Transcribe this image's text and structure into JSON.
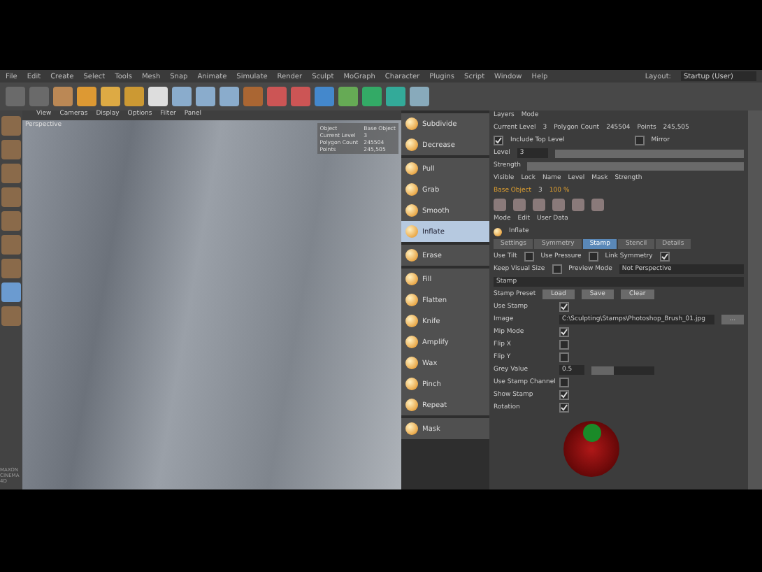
{
  "menu": [
    "File",
    "Edit",
    "Create",
    "Select",
    "Tools",
    "Mesh",
    "Snap",
    "Animate",
    "Simulate",
    "Render",
    "Sculpt",
    "MoGraph",
    "Character",
    "Plugins",
    "Script",
    "Window",
    "Help"
  ],
  "layout": {
    "label": "Layout:",
    "value": "Startup (User)"
  },
  "viewport": {
    "menu": [
      "View",
      "Cameras",
      "Display",
      "Options",
      "Filter",
      "Panel"
    ],
    "camera": "Perspective",
    "hud": [
      {
        "label": "Object",
        "value": "Base Object"
      },
      {
        "label": "Current Level",
        "value": "3"
      },
      {
        "label": "Polygon Count",
        "value": "245504"
      },
      {
        "label": "Points",
        "value": "245,505"
      }
    ]
  },
  "logo": {
    "name": "MAXON",
    "sub": "CINEMA 4D"
  },
  "brush_groups": [
    [
      {
        "label": "Subdivide",
        "selected": false
      },
      {
        "label": "Decrease",
        "selected": false
      }
    ],
    [
      {
        "label": "Pull",
        "selected": false
      },
      {
        "label": "Grab",
        "selected": false
      },
      {
        "label": "Smooth",
        "selected": false
      },
      {
        "label": "Inflate",
        "selected": true
      }
    ],
    [
      {
        "label": "Erase",
        "selected": false
      }
    ],
    [
      {
        "label": "Fill",
        "selected": false
      },
      {
        "label": "Flatten",
        "selected": false
      },
      {
        "label": "Knife",
        "selected": false
      },
      {
        "label": "Amplify",
        "selected": false
      },
      {
        "label": "Wax",
        "selected": false
      },
      {
        "label": "Pinch",
        "selected": false
      },
      {
        "label": "Repeat",
        "selected": false
      }
    ],
    [
      {
        "label": "Mask",
        "selected": false
      }
    ]
  ],
  "layers": {
    "menu": [
      "Layers",
      "Mode"
    ],
    "current_level": {
      "label": "Current Level",
      "value": "3"
    },
    "polygons": {
      "label": "Polygon Count",
      "value": "245504"
    },
    "points": {
      "label": "Points",
      "value": "245,505"
    },
    "include_top": {
      "label": "Include Top Level",
      "checked": true
    },
    "mirror": {
      "label": "Mirror",
      "checked": false
    },
    "level_label": "Level",
    "level_value": "3",
    "strength_label": "Strength",
    "columns": [
      "Visible",
      "Lock",
      "Name",
      "Level",
      "Mask",
      "Strength"
    ],
    "row": {
      "name": "Base Object",
      "level": "3",
      "strength": "100 %"
    }
  },
  "attributes": {
    "menu": [
      "Mode",
      "Edit",
      "User Data"
    ],
    "title": "Inflate",
    "tabs": [
      {
        "label": "Settings",
        "selected": false
      },
      {
        "label": "Symmetry",
        "selected": false
      },
      {
        "label": "Stamp",
        "selected": true
      },
      {
        "label": "Stencil",
        "selected": false
      },
      {
        "label": "Details",
        "selected": false
      }
    ],
    "options": [
      {
        "label": "Use Tilt",
        "checked": false
      },
      {
        "label": "Use Pressure",
        "checked": false
      },
      {
        "label": "Link Symmetry",
        "checked": true
      }
    ],
    "visual": {
      "label": "Keep Visual Size",
      "checked": false,
      "mode_label": "Preview Mode",
      "mode": "Not Perspective"
    },
    "section": "Stamp",
    "preset": {
      "label": "Stamp Preset",
      "buttons": [
        "Load",
        "Save",
        "Clear"
      ]
    },
    "rows": [
      {
        "label": "Use Stamp",
        "kind": "check",
        "checked": true
      },
      {
        "label": "Image",
        "kind": "path",
        "value": "C:\\Sculpting\\Stamps\\Photoshop_Brush_01.jpg",
        "button": "..."
      },
      {
        "label": "Mip Mode",
        "kind": "check",
        "checked": true
      },
      {
        "label": "Flip X",
        "kind": "check",
        "checked": false
      },
      {
        "label": "Flip Y",
        "kind": "check",
        "checked": false
      },
      {
        "label": "Grey Value",
        "kind": "slider",
        "value": "0.5",
        "level": 0.35
      },
      {
        "label": "Use Stamp Channel",
        "kind": "check",
        "checked": false
      },
      {
        "label": "Show Stamp",
        "kind": "check",
        "checked": true
      },
      {
        "label": "Rotation",
        "kind": "check",
        "checked": true
      }
    ]
  }
}
